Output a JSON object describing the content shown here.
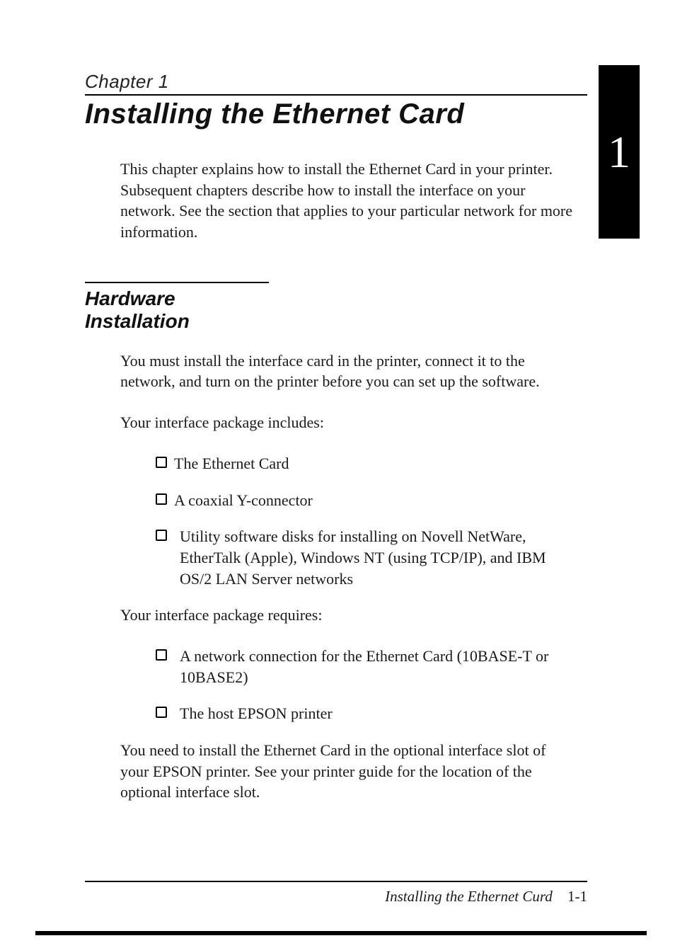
{
  "chapter_label": "Chapter 1",
  "chapter_title": "Installing the Ethernet Card",
  "side_tab": "1",
  "intro": "This chapter explains how to install the Ethernet Card in your printer. Subsequent chapters describe how to install the interface on your network. See the section that applies to your particular network for more information.",
  "section1": {
    "heading": "Hardware Installation",
    "p1": "You must install the interface card in the printer, connect it to the network, and turn on the printer before you can set up the software.",
    "p2": "Your interface package includes:",
    "includes": [
      "The Ethernet Card",
      "A coaxial Y-connector",
      "Utility software disks for installing on Novell NetWare, EtherTalk (Apple), Windows NT (using TCP/IP), and IBM OS/2 LAN Server networks"
    ],
    "p3": "Your interface package requires:",
    "requires": [
      "A network connection for the Ethernet Card (10BASE-T or 10BASE2)",
      "The host EPSON printer"
    ],
    "p4": "You need to install the Ethernet Card in the optional interface slot of your EPSON printer. See your printer guide for the location of the optional interface slot."
  },
  "footer": {
    "running_title": "Installing the Ethernet Curd",
    "page_number": "1-1"
  }
}
